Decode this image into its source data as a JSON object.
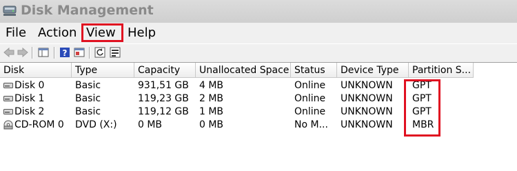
{
  "window": {
    "title": "Disk Management",
    "icon": "disk-management-icon"
  },
  "menu": {
    "items": [
      "File",
      "Action",
      "View",
      "Help"
    ],
    "highlighted": "View"
  },
  "toolbar": {
    "buttons": [
      "back-icon",
      "forward-icon",
      "console-view-icon",
      "help-icon",
      "properties-icon",
      "refresh-icon",
      "export-icon"
    ]
  },
  "table": {
    "columns": [
      "Disk",
      "Type",
      "Capacity",
      "Unallocated Space",
      "Status",
      "Device Type",
      "Partition S..."
    ],
    "rows": [
      {
        "icon": "hard-disk-icon",
        "disk": "Disk 0",
        "type": "Basic",
        "capacity": "931,51 GB",
        "unallocated": "4 MB",
        "status": "Online",
        "device_type": "UNKNOWN",
        "partition_style": "GPT"
      },
      {
        "icon": "hard-disk-icon",
        "disk": "Disk 1",
        "type": "Basic",
        "capacity": "119,23 GB",
        "unallocated": "2 MB",
        "status": "Online",
        "device_type": "UNKNOWN",
        "partition_style": "GPT"
      },
      {
        "icon": "hard-disk-icon",
        "disk": "Disk 2",
        "type": "Basic",
        "capacity": "119,12 GB",
        "unallocated": "1 MB",
        "status": "Online",
        "device_type": "UNKNOWN",
        "partition_style": "GPT"
      },
      {
        "icon": "cd-rom-icon",
        "disk": "CD-ROM 0",
        "type": "DVD (X:)",
        "capacity": "0 MB",
        "unallocated": "0 MB",
        "status": "No M...",
        "device_type": "UNKNOWN",
        "partition_style": "MBR"
      }
    ]
  },
  "colors": {
    "highlight": "#e01020",
    "title_text": "#8a8a8a",
    "toolbar_help": "#2a4bb8"
  }
}
